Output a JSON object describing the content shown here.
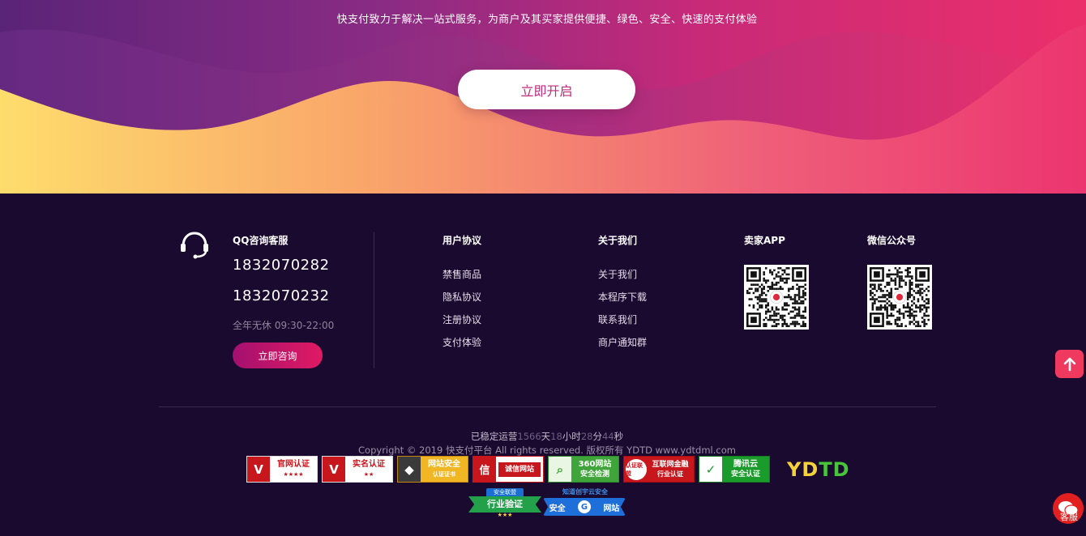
{
  "hero": {
    "tagline": "快支付致力于解决一站式服务，为商户及其买家提供便捷、绿色、安全、快速的支付体验",
    "start_button": "立即开启"
  },
  "contact": {
    "title": "QQ咨询客服",
    "phone1": "1832070282",
    "phone2": "1832070232",
    "hours": "全年无休 09:30-22:00",
    "consult_button": "立即咨询",
    "icon": "headset-icon"
  },
  "columns": {
    "user_agreement": {
      "title": "用户协议",
      "links": [
        "禁售商品",
        "隐私协议",
        "注册协议",
        "支付体验"
      ]
    },
    "about": {
      "title": "关于我们",
      "links": [
        "关于我们",
        "本程序下载",
        "联系我们",
        "商户通知群"
      ]
    },
    "seller_app": {
      "title": "卖家APP"
    },
    "wechat": {
      "title": "微信公众号"
    }
  },
  "uptime": {
    "prefix": "已稳定运营",
    "days": "1566",
    "days_unit": "天",
    "hours": "18",
    "hours_unit": "小时",
    "minutes": "28",
    "minutes_unit": "分",
    "seconds": "44",
    "seconds_unit": "秒"
  },
  "copyright": "Copyright © 2019 快支付平台 All rights reserved. 版权所有 YDTD www.ydtdml.com",
  "badges": {
    "official": "官网认证",
    "official_stars": "★★★★",
    "realname": "实名认证",
    "realname_stars": "★★",
    "site_safety": "网站安全",
    "site_safety_sub": "认证证书",
    "credit": "诚信网站",
    "credit_mark": "信",
    "s360": "360网站",
    "s360_sub": "安全检测",
    "finance": "互联网金融",
    "finance_sub": "行业认证",
    "finance_mark": "认证联盟",
    "tencent": "腾讯云",
    "tencent_sub": "安全认证",
    "ydtd_a": "YD",
    "ydtd_b": "TD",
    "industry_top": "安全联盟",
    "industry": "行业验证",
    "industry_stars": "★★★",
    "chuangyu_top": "知道创宇云安全",
    "chuangyu_left": "安全",
    "chuangyu_right": "网站"
  },
  "floating": {
    "chat_label": "客服"
  },
  "colors": {
    "footer_bg": "#1b0a30",
    "accent_pink": "#ec2f6a",
    "accent_purple": "#5a2478",
    "wave_yellow": "#fdd86a"
  }
}
